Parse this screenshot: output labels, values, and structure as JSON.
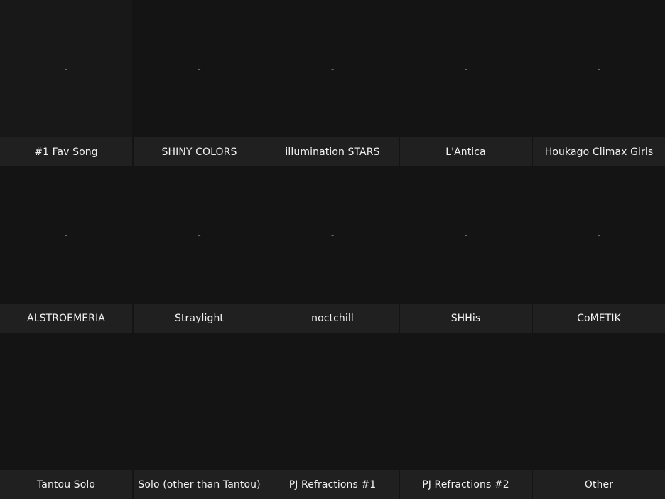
{
  "grid": {
    "cells": [
      {
        "image": "-",
        "label": "#1 Fav Song"
      },
      {
        "image": "-",
        "label": "SHINY COLORS"
      },
      {
        "image": "-",
        "label": "illumination STARS"
      },
      {
        "image": "-",
        "label": "L'Antica"
      },
      {
        "image": "-",
        "label": "Houkago Climax Girls"
      },
      {
        "image": "-",
        "label": "ALSTROEMERIA"
      },
      {
        "image": "-",
        "label": "Straylight"
      },
      {
        "image": "-",
        "label": "noctchill"
      },
      {
        "image": "-",
        "label": "SHHis"
      },
      {
        "image": "-",
        "label": "CoMETIK"
      },
      {
        "image": "-",
        "label": "Tantou Solo"
      },
      {
        "image": "-",
        "label": "Solo (other than Tantou)"
      },
      {
        "image": "-",
        "label": "PJ Refractions #1"
      },
      {
        "image": "-",
        "label": "PJ Refractions #2"
      },
      {
        "image": "-",
        "label": "Other"
      }
    ]
  },
  "colors": {
    "background": "#141414",
    "label_background": "#202020",
    "label_text": "#f2f2f2",
    "placeholder_text": "#6a6a6a"
  }
}
